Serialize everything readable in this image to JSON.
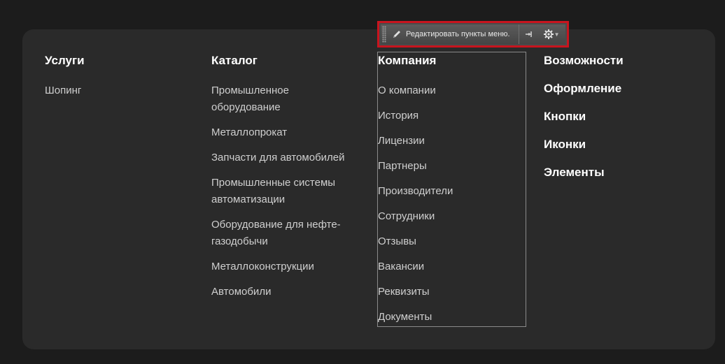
{
  "toolbar": {
    "edit_label": "Редактировать пункты меню.",
    "icons": [
      "pencil-icon",
      "pin-icon",
      "gear-icon",
      "chevron-down-icon"
    ]
  },
  "columns": {
    "services": {
      "title": "Услуги",
      "items": [
        "Шопинг"
      ]
    },
    "catalog": {
      "title": "Каталог",
      "items": [
        "Промышленное оборудование",
        "Металлопрокат",
        "Запчасти для автомобилей",
        "Промышленные системы автоматизации",
        "Оборудование для нефте-газодобычи",
        "Металлоконструкции",
        "Автомобили"
      ]
    },
    "company": {
      "title": "Компания",
      "items": [
        "О компании",
        "История",
        "Лицензии",
        "Партнеры",
        "Производители",
        "Сотрудники",
        "Отзывы",
        "Вакансии",
        "Реквизиты",
        "Документы"
      ]
    },
    "features": {
      "items": [
        "Возможности",
        "Оформление",
        "Кнопки",
        "Иконки",
        "Элементы"
      ]
    }
  },
  "colors": {
    "page_bg": "#1c1c1c",
    "panel_bg": "#2a2a2a",
    "title": "#ffffff",
    "link": "#cfcfcf",
    "highlight_border": "#c8141e"
  }
}
